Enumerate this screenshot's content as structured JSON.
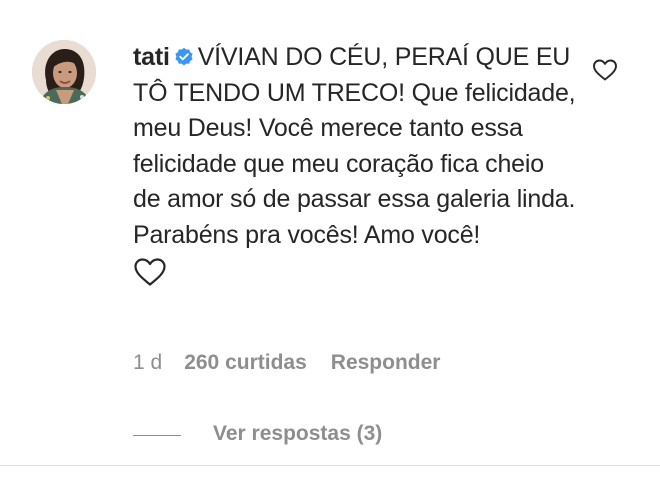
{
  "comment": {
    "username": "tati",
    "verified": true,
    "text": "VÍVIAN DO CÉU, PERAÍ QUE EU TÔ TENDO UM TRECO! Que felicidade, meu Deus! Você merece tanto essa felicidade que meu coração fica cheio de amor só de passar essa galeria linda. Parabéns pra vocês! Amo você!",
    "inline_emoji": "heart-outline-icon",
    "time": "1 d",
    "likes": "260 curtidas",
    "reply_label": "Responder",
    "view_replies_label": "Ver respostas (3)"
  },
  "colors": {
    "text": "#262626",
    "muted": "#8e8e8e",
    "verified_badge": "#3897f0",
    "divider": "#e3e3e3"
  }
}
